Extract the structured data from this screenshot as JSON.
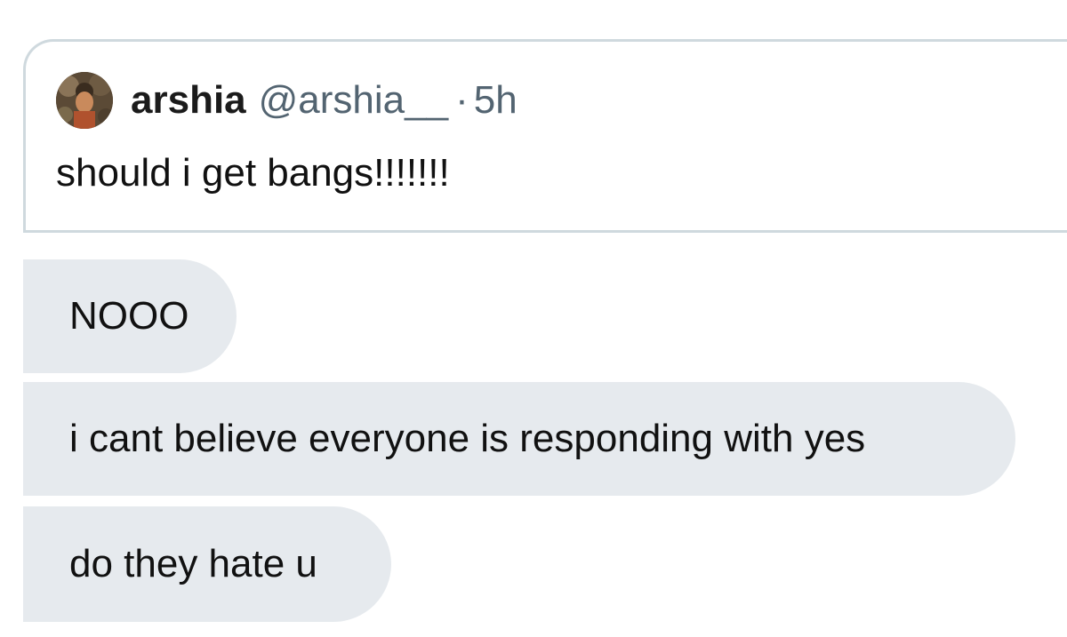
{
  "quoted_tweet": {
    "author_name": "arshia",
    "author_handle": "@arshia__",
    "separator": "·",
    "timestamp": "5h",
    "text": "should i get bangs!!!!!!!"
  },
  "messages": [
    {
      "text": "NOOO"
    },
    {
      "text": "i cant believe everyone is responding with yes"
    },
    {
      "text": "do they hate u"
    }
  ],
  "colors": {
    "bubble_bg": "#e6eaee",
    "card_border": "#cfd9de",
    "secondary_text": "#536471",
    "primary_text": "#111111"
  }
}
